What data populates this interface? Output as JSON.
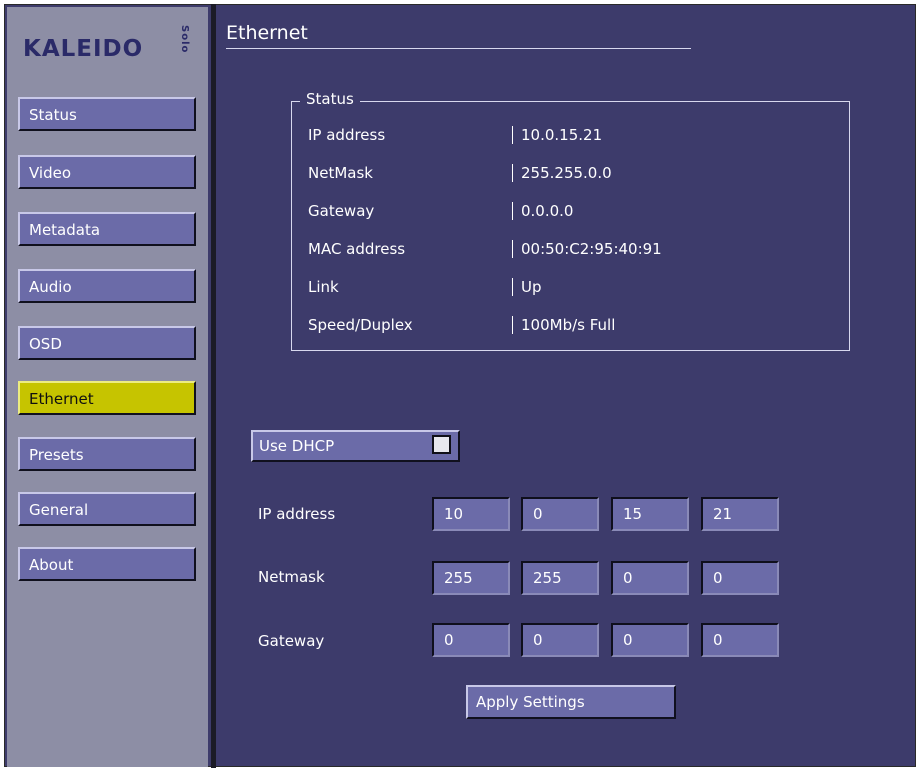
{
  "logo": {
    "brand": "KALEIDO",
    "sub": "Solo"
  },
  "nav": {
    "items": [
      {
        "label": "Status"
      },
      {
        "label": "Video"
      },
      {
        "label": "Metadata"
      },
      {
        "label": "Audio"
      },
      {
        "label": "OSD"
      },
      {
        "label": "Ethernet",
        "active": true
      },
      {
        "label": "Presets"
      },
      {
        "label": "General"
      },
      {
        "label": "About"
      }
    ]
  },
  "page": {
    "title": "Ethernet"
  },
  "status": {
    "legend": "Status",
    "rows": [
      {
        "label": "IP address",
        "value": "10.0.15.21"
      },
      {
        "label": "NetMask",
        "value": "255.255.0.0"
      },
      {
        "label": "Gateway",
        "value": "0.0.0.0"
      },
      {
        "label": "MAC address",
        "value": "00:50:C2:95:40:91"
      },
      {
        "label": "Link",
        "value": "Up"
      },
      {
        "label": "Speed/Duplex",
        "value": "100Mb/s  Full"
      }
    ]
  },
  "form": {
    "dhcp_label": "Use DHCP",
    "dhcp_checked": false,
    "ip_label": "IP address",
    "ip": [
      "10",
      "0",
      "15",
      "21"
    ],
    "netmask_label": "Netmask",
    "netmask": [
      "255",
      "255",
      "0",
      "0"
    ],
    "gateway_label": "Gateway",
    "gateway": [
      "0",
      "0",
      "0",
      "0"
    ],
    "apply_label": "Apply Settings"
  },
  "colors": {
    "background": "#3d3b6b",
    "sidebar": "#8d8ea5",
    "button": "#6b6ba8",
    "active": "#c6c400"
  }
}
